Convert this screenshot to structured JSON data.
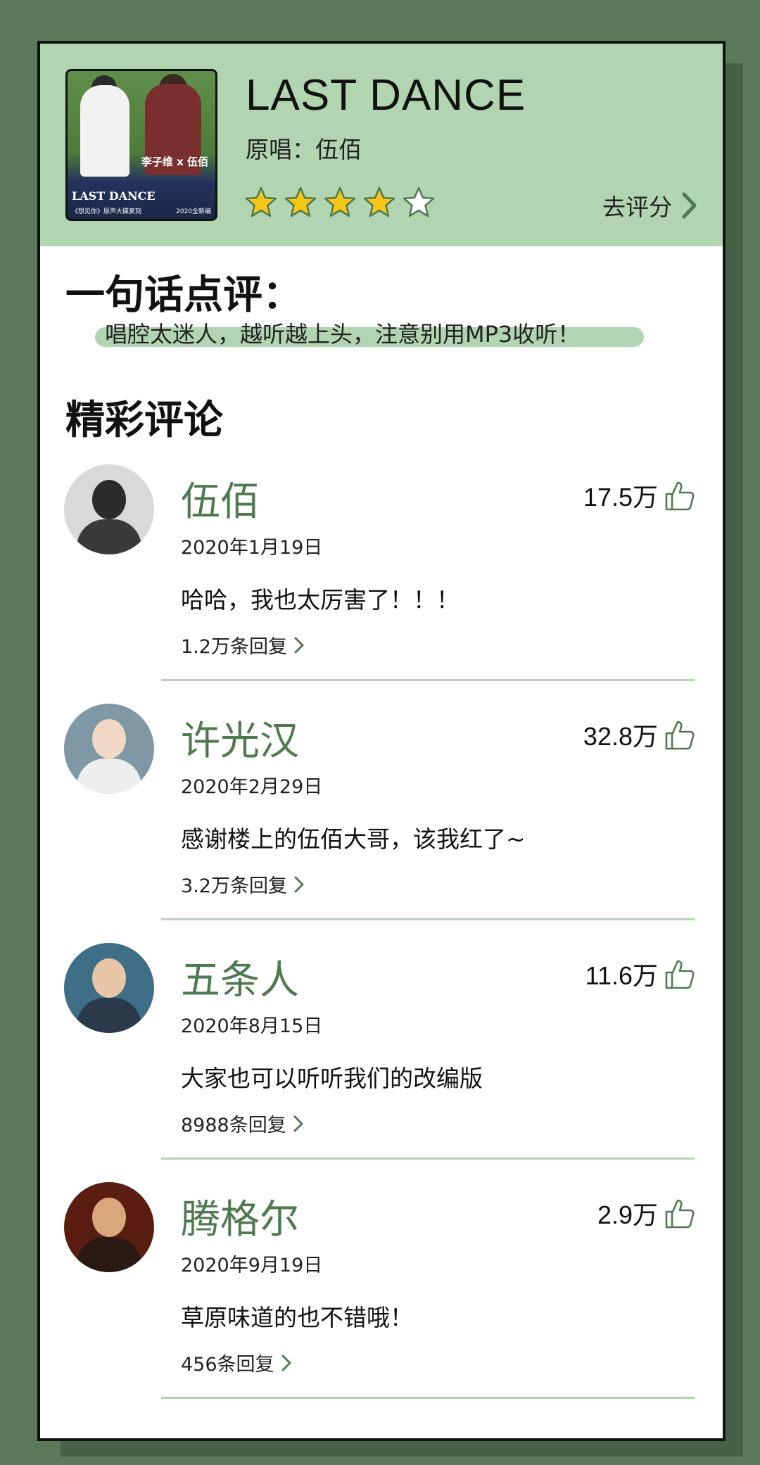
{
  "header": {
    "song_title": "LAST DANCE",
    "artist_line": "原唱：伍佰",
    "rating_stars": 4,
    "rating_max": 5,
    "rate_link": "去评分",
    "cover": {
      "names": "李子维 x 伍佰",
      "title": "LAST DANCE",
      "subtitle": "《想见你》原声大碟复刻",
      "edition": "2020全新编"
    }
  },
  "one_line_review": {
    "title": "一句话点评：",
    "text": "唱腔太迷人，越听越上头，注意别用MP3收听！"
  },
  "comments_section": {
    "title": "精彩评论",
    "items": [
      {
        "user": "伍佰",
        "likes": "17.5万",
        "date": "2020年1月19日",
        "text": "哈哈，我也太厉害了！！！",
        "replies": "1.2万条回复"
      },
      {
        "user": "许光汉",
        "likes": "32.8万",
        "date": "2020年2月29日",
        "text": "感谢楼上的伍佰大哥，该我红了~",
        "replies": "3.2万条回复"
      },
      {
        "user": "五条人",
        "likes": "11.6万",
        "date": "2020年8月15日",
        "text": "大家也可以听听我们的改编版",
        "replies": "8988条回复"
      },
      {
        "user": "腾格尔",
        "likes": "2.9万",
        "date": "2020年9月19日",
        "text": "草原味道的也不错哦！",
        "replies": "456条回复"
      }
    ]
  },
  "colors": {
    "page_bg": "#5a7a5a",
    "accent_green": "#b1d4b1",
    "username_green": "#4f7a4f",
    "star_fill": "#f5c518"
  }
}
